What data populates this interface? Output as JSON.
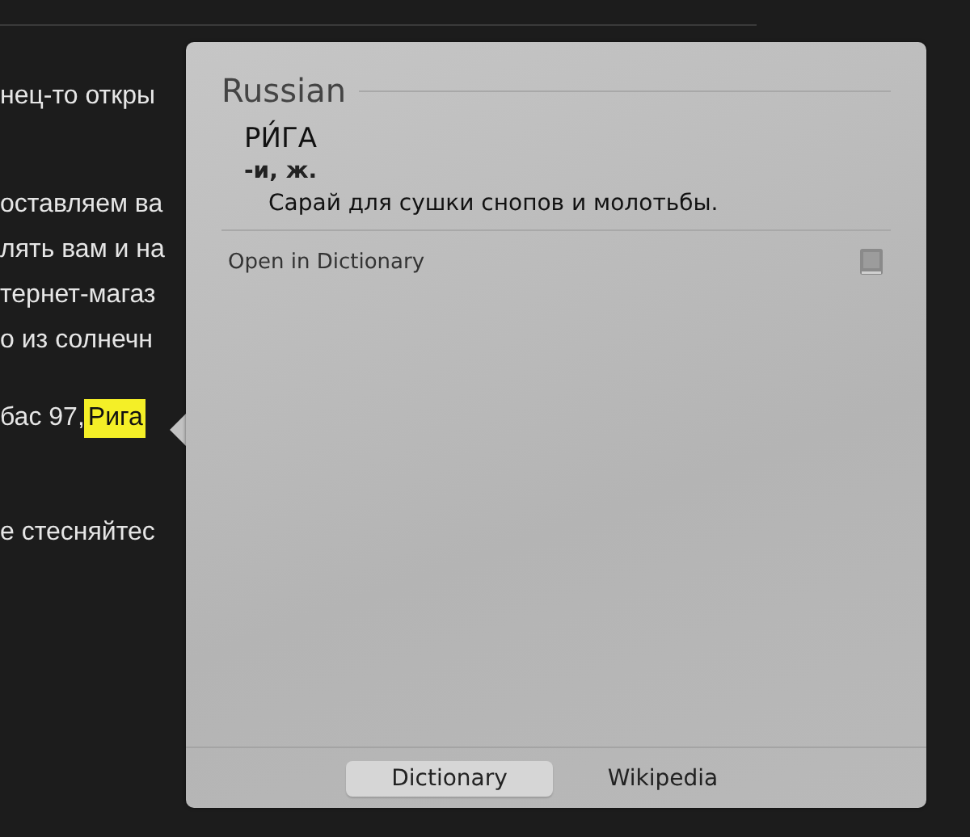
{
  "article_paragraphs": [
    [
      {
        "text": "нец-то откры"
      }
    ],
    [
      {
        "text": "оставляем ва"
      },
      {
        "text": "лять вам и на"
      },
      {
        "text": "тернет-магаз"
      },
      {
        "text": "о из солнечн"
      }
    ],
    [
      {
        "text": "бас 97, ",
        "highlight": "Рига"
      }
    ],
    [
      {
        "text": "е стесняйтес"
      }
    ]
  ],
  "popup": {
    "language": "Russian",
    "headword": "РИ́ГА",
    "grammar": "-и, ж.",
    "definition": "Сарай для сушки снопов и молотьбы.",
    "open_link": "Open in Dictionary",
    "tabs": [
      {
        "label": "Dictionary",
        "selected": true
      },
      {
        "label": "Wikipedia",
        "selected": false
      }
    ]
  }
}
